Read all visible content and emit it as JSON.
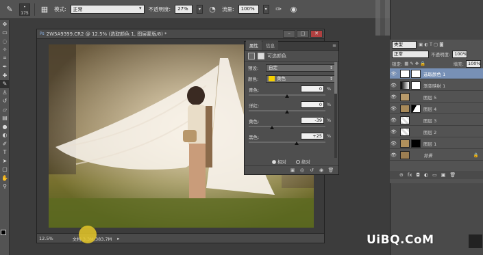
{
  "options_bar": {
    "brush_size": "175",
    "mode_label": "模式:",
    "mode_value": "正常",
    "opacity_label": "不透明度:",
    "opacity_value": "27%",
    "flow_label": "流量:",
    "flow_value": "100%"
  },
  "document": {
    "title": "2W5A9399.CR2 @ 12.5% (选取颜色 1, 图层蒙版/8) *",
    "zoom": "12.5%",
    "doc_info": "文档:3.3M/383.7M"
  },
  "properties": {
    "tab_properties": "属性",
    "tab_info": "信息",
    "header": "可选颜色",
    "preset_label": "预设:",
    "preset_value": "自定",
    "colors_label": "颜色:",
    "colors_value": "黄色",
    "sliders": [
      {
        "name": "青色:",
        "value": "0",
        "unit": "%",
        "fraction": 0.5
      },
      {
        "name": "洋红:",
        "value": "0",
        "unit": "%",
        "fraction": 0.5
      },
      {
        "name": "黄色:",
        "value": "-39",
        "unit": "%",
        "fraction": 0.305
      },
      {
        "name": "黑色:",
        "value": "+25",
        "unit": "%",
        "fraction": 0.625
      }
    ],
    "radio_relative": "相对",
    "radio_absolute": "绝对"
  },
  "layers_panel": {
    "kind_value": "类型",
    "blend_value": "正常",
    "opacity_label": "不透明度:",
    "opacity_value": "100%",
    "lock_label": "锁定:",
    "fill_label": "填充:",
    "fill_value": "100%",
    "layers": [
      {
        "name": "选取颜色 1",
        "selected": true
      },
      {
        "name": "渐变映射 1",
        "selected": false
      },
      {
        "name": "图层 5",
        "selected": false
      },
      {
        "name": "图层 4",
        "selected": false
      },
      {
        "name": "图层 3",
        "selected": false
      },
      {
        "name": "图层 2",
        "selected": false
      },
      {
        "name": "图层 1",
        "selected": false
      },
      {
        "name": "背景",
        "selected": false
      }
    ]
  },
  "watermark": "UiBQ.CoM",
  "colors": {
    "accent_selection": "#7790b6",
    "yellow_swatch": "#f5d000"
  }
}
